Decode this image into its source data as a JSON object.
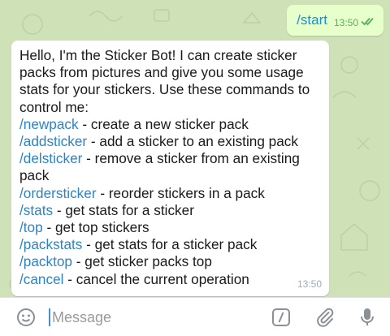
{
  "chat": {
    "outgoing": {
      "text": "/start",
      "time": "13:50",
      "status_icon": "double-check-icon"
    },
    "incoming": {
      "intro": "Hello, I'm the Sticker Bot! I can create sticker packs from pictures and give you some usage stats for your stickers. Use these commands to control me:",
      "commands": [
        {
          "cmd": "/newpack",
          "desc": " - create a new sticker pack"
        },
        {
          "cmd": "/addsticker",
          "desc": " - add a sticker to an existing pack"
        },
        {
          "cmd": "/delsticker",
          "desc": " - remove a sticker from an existing pack"
        },
        {
          "cmd": "/ordersticker",
          "desc": " - reorder stickers in a pack"
        },
        {
          "cmd": "/stats",
          "desc": " - get stats for a sticker"
        },
        {
          "cmd": "/top",
          "desc": " - get top stickers"
        },
        {
          "cmd": "/packstats",
          "desc": " - get stats for a sticker pack"
        },
        {
          "cmd": "/packtop",
          "desc": " - get sticker packs top"
        },
        {
          "cmd": "/cancel",
          "desc": " - cancel the current operation"
        }
      ],
      "time": "13:50"
    }
  },
  "input": {
    "placeholder": "Message",
    "icons": [
      "emoji-icon",
      "bot-command-icon",
      "attach-icon",
      "microphone-icon"
    ]
  },
  "colors": {
    "chat_bg": "#cfe1b7",
    "outgoing_bubble": "#e6ffcb",
    "command_link": "#2d84c3",
    "outgoing_time": "#5cad62"
  }
}
